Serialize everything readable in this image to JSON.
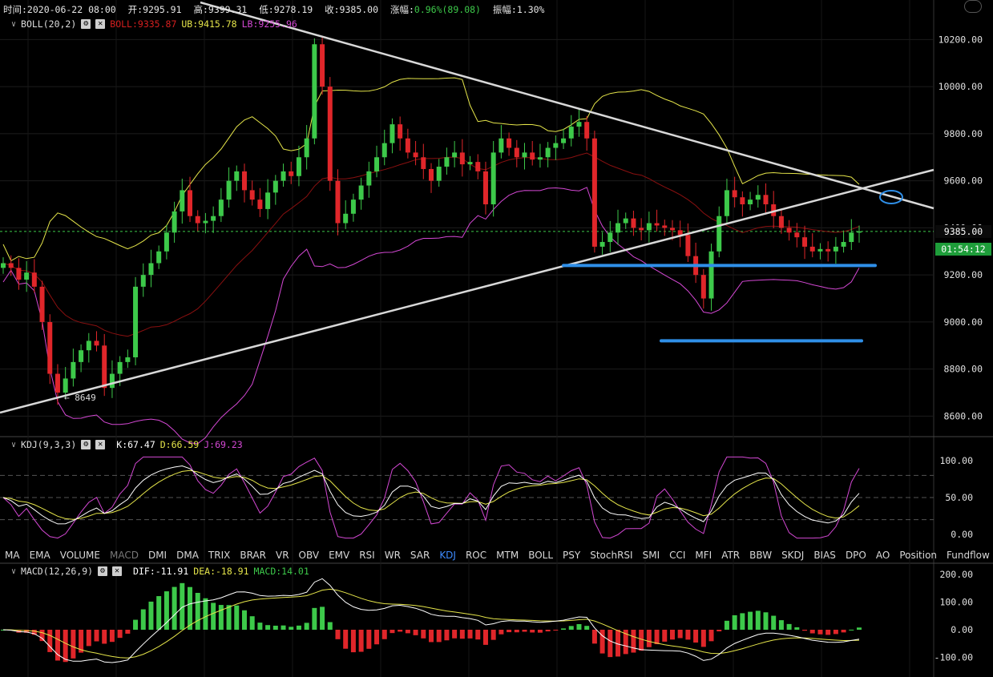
{
  "topbar": {
    "time": "时间:2020-06-22 08:00",
    "open": "开:9295.91",
    "high": "高:9399.31",
    "low": "低:9278.19",
    "close": "收:9385.00",
    "change_label": "涨幅:",
    "change_value": "0.96%(89.08)",
    "amplitude": "振幅:1.30%"
  },
  "boll": {
    "name": "BOLL(20,2)",
    "mid": "BOLL:9335.87",
    "ub": "UB:9415.78",
    "lb": "LB:9255.96",
    "colors": {
      "mid": "#d61f1f",
      "ub": "#e5e54a",
      "lb": "#d448d4"
    }
  },
  "kdj": {
    "name": "KDJ(9,3,3)",
    "k": "K:67.47",
    "d": "D:66.59",
    "j": "J:69.23"
  },
  "macd": {
    "name": "MACD(12,26,9)",
    "dif": "DIF:-11.91",
    "dea": "DEA:-18.91",
    "macd": "MACD:14.01"
  },
  "indicator_tabs": [
    "MA",
    "EMA",
    "VOLUME",
    "MACD",
    "DMI",
    "DMA",
    "TRIX",
    "BRAR",
    "VR",
    "OBV",
    "EMV",
    "RSI",
    "WR",
    "SAR",
    "KDJ",
    "ROC",
    "MTM",
    "BOLL",
    "PSY",
    "StochRSI",
    "SMI",
    "CCI",
    "MFI",
    "ATR",
    "BBW",
    "SKDJ",
    "BIAS",
    "DPO",
    "AO",
    "Position",
    "Fundflow"
  ],
  "active_tab": "KDJ",
  "dim_tab": "MACD",
  "price_axis": [
    "10200.00",
    "10000.00",
    "9800.00",
    "9600.00",
    "9400.00",
    "9200.00",
    "9000.00",
    "8800.00",
    "8600.00"
  ],
  "kdj_axis": [
    "100.00",
    "50.00",
    "0.00"
  ],
  "macd_axis": [
    "200.00",
    "100.00",
    "0.00",
    "-100.00"
  ],
  "last_price": "9385.00",
  "countdown": "01:54:12",
  "low_marker": "8649",
  "colors": {
    "up": "#3dc94a",
    "down": "#e0262a",
    "trend": "#d8d8d8",
    "annotation": "#2f8fe8"
  },
  "chart_data": {
    "type": "candlestick",
    "ylim": [
      8530,
      10300
    ],
    "close_series": [
      9250,
      9230,
      9180,
      9210,
      9150,
      9000,
      8780,
      8700,
      8760,
      8830,
      8880,
      8920,
      8900,
      8720,
      8780,
      8830,
      8850,
      9150,
      9200,
      9250,
      9300,
      9380,
      9470,
      9560,
      9450,
      9420,
      9430,
      9450,
      9520,
      9600,
      9640,
      9560,
      9520,
      9480,
      9550,
      9600,
      9640,
      9620,
      9700,
      9780,
      10180,
      10000,
      9600,
      9420,
      9460,
      9520,
      9580,
      9640,
      9700,
      9760,
      9840,
      9780,
      9720,
      9700,
      9650,
      9600,
      9660,
      9700,
      9720,
      9670,
      9680,
      9640,
      9500,
      9720,
      9780,
      9740,
      9700,
      9720,
      9690,
      9700,
      9740,
      9760,
      9780,
      9830,
      9850,
      9780,
      9320,
      9340,
      9380,
      9420,
      9440,
      9400,
      9390,
      9420,
      9410,
      9400,
      9390,
      9370,
      9280,
      9200,
      9100,
      9300,
      9450,
      9560,
      9530,
      9500,
      9520,
      9540,
      9500,
      9450,
      9400,
      9380,
      9360,
      9320,
      9300,
      9310,
      9300,
      9320,
      9340,
      9380,
      9385
    ],
    "bands": {
      "ub_end": 9415.78,
      "mid_end": 9335.87,
      "lb_end": 9255.96
    },
    "horizontal_levels": [
      9240,
      8920
    ],
    "kdj_end": {
      "k": 67.47,
      "d": 66.59,
      "j": 69.23
    },
    "macd_end": {
      "dif": -11.91,
      "dea": -18.91,
      "macd": 14.01
    }
  }
}
